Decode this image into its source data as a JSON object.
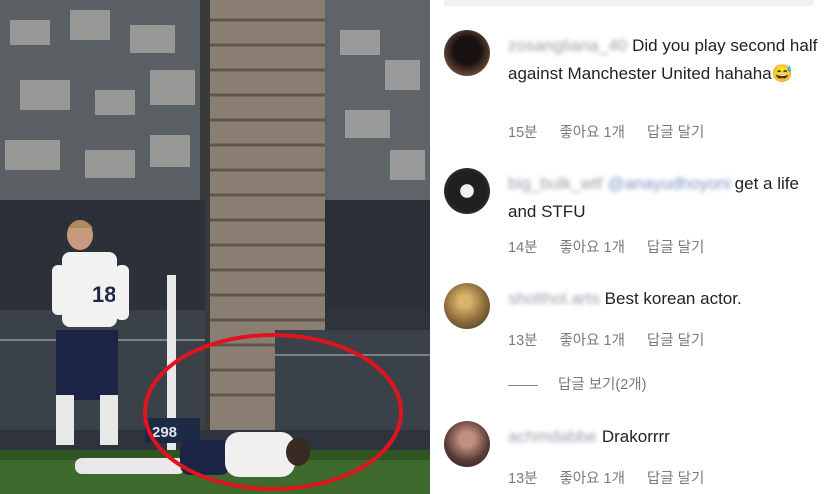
{
  "comments": [
    {
      "username": "zosangliana_40",
      "text": "Did you play second half against Manchester United hahaha😅",
      "time": "15분",
      "likes": "좋아요 1개",
      "reply": "답글 달기"
    },
    {
      "username": "big_bulk_wtf",
      "mention": "@anayudhoyoni",
      "text": "get a life and STFU",
      "time": "14분",
      "likes": "좋아요 1개",
      "reply": "답글 달기"
    },
    {
      "username": "sholthol.arts",
      "text": "Best korean actor.",
      "time": "13분",
      "likes": "좋아요 1개",
      "reply": "답글 달기",
      "view_replies": "답글 보기(2개)"
    },
    {
      "username": "achmdabbe",
      "text": "Drakorrrr",
      "time": "13분",
      "likes": "좋아요 1개",
      "reply": "답글 달기"
    }
  ],
  "photo": {
    "player_number": "18",
    "board_number": "298",
    "highlight_color": "#e0141e"
  }
}
